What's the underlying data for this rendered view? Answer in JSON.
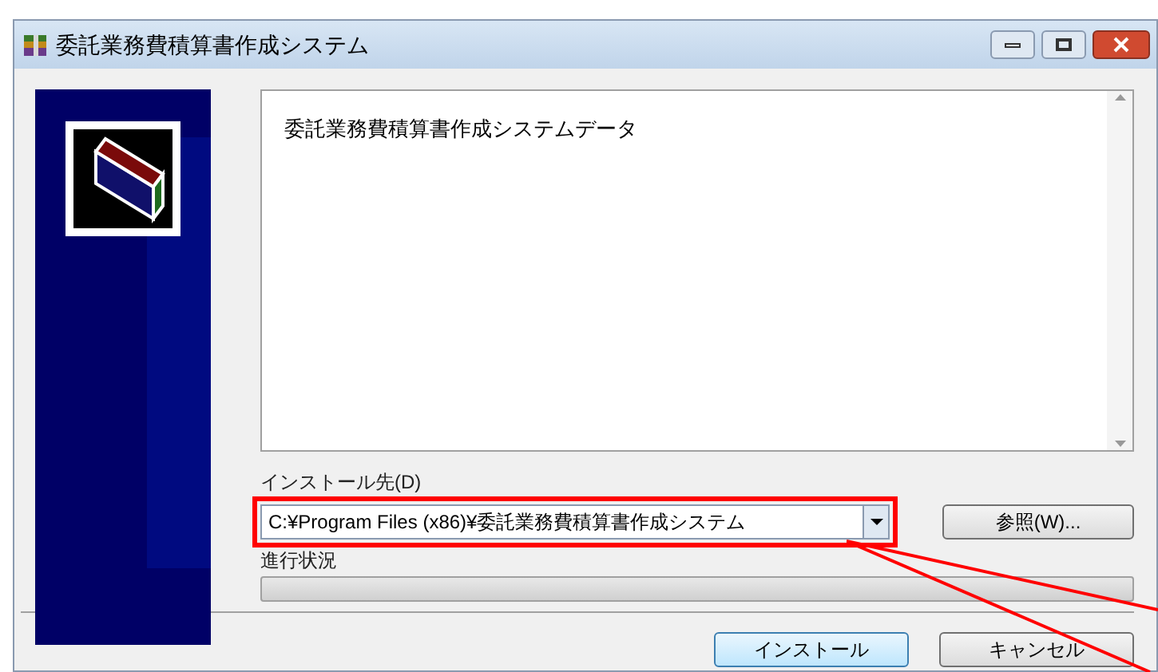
{
  "window": {
    "title": "委託業務費積算書作成システム"
  },
  "description": {
    "text": "委託業務費積算書作成システムデータ"
  },
  "install_path": {
    "label": "インストール先(D)",
    "value": "C:¥Program Files (x86)¥委託業務費積算書作成システム",
    "highlighted": true
  },
  "browse_button": {
    "label": "参照(W)..."
  },
  "progress": {
    "label": "進行状況",
    "level": 0
  },
  "buttons": [
    {
      "label": "インストール",
      "kind": "default"
    },
    {
      "label": "キャンセル",
      "kind": "normal"
    }
  ]
}
